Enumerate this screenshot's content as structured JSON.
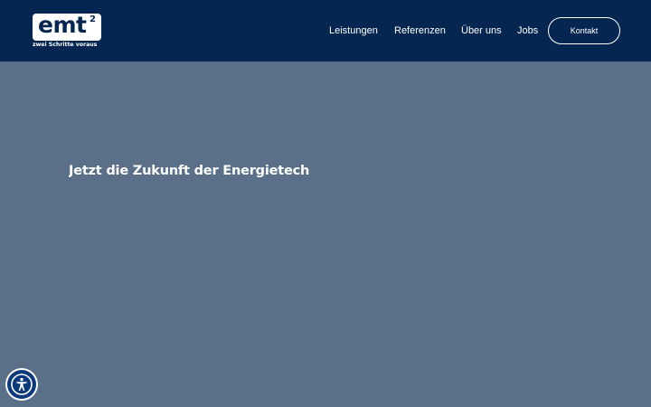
{
  "brand": {
    "logo_text": "emt",
    "logo_superscript": "2",
    "tagline": "zwei Schritte voraus",
    "primary_color": "#042650",
    "hero_color": "#5a6f88"
  },
  "nav": {
    "items": [
      {
        "label": "Leistungen"
      },
      {
        "label": "Referenzen"
      },
      {
        "label": "Über uns"
      },
      {
        "label": "Jobs"
      }
    ],
    "contact_label": "Kontakt"
  },
  "hero": {
    "title": "Jetzt die Zukunft der Energietech"
  },
  "accessibility": {
    "icon": "accessibility-icon"
  }
}
